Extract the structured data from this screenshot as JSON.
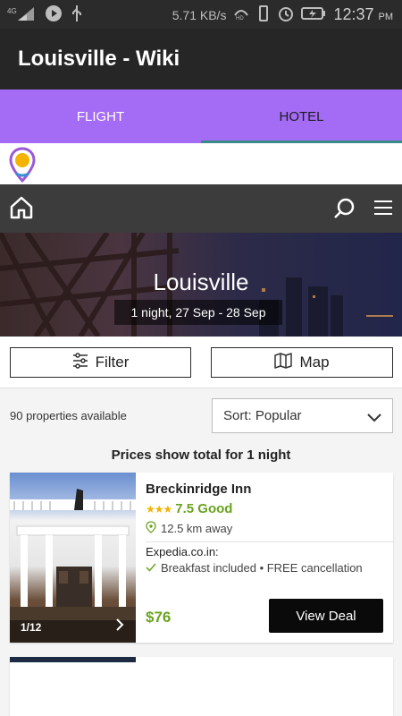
{
  "status_bar": {
    "net_speed": "5.71 KB/s",
    "time": "12:37",
    "ampm": "PM",
    "icons": [
      "signal-4g-icon",
      "play-icon",
      "usb-icon",
      "hd-icon",
      "vibrate-icon",
      "alarm-icon",
      "battery-icon"
    ]
  },
  "app_bar": {
    "title": "Louisville - Wiki"
  },
  "tabs": [
    {
      "label": "FLIGHT",
      "active": false
    },
    {
      "label": "HOTEL",
      "active": true
    }
  ],
  "site_header": {
    "icons": [
      "location-pin-logo",
      "home-icon",
      "search-icon",
      "hamburger-menu-icon"
    ]
  },
  "hero": {
    "city": "Louisville",
    "dates": "1 night, 27 Sep - 28 Sep"
  },
  "filter_bar": {
    "filter_label": "Filter",
    "map_label": "Map"
  },
  "results": {
    "count_text": "90 properties available",
    "sort_label": "Sort: Popular",
    "price_note": "Prices show total for 1 night"
  },
  "hotels": [
    {
      "name": "Breckinridge Inn",
      "stars": 3,
      "rating": "7.5 Good",
      "distance": "12.5 km away",
      "provider": "Expedia.co.in:",
      "perks": "Breakfast included • FREE cancellation",
      "price": "$76",
      "photo_counter": "1/12",
      "cta": "View Deal"
    }
  ],
  "colors": {
    "tab_bar": "#a46bf5",
    "app_bar": "#262626",
    "site_header": "#3c3c3c",
    "accent_green": "#6aa321",
    "star_yellow": "#f2b400",
    "tab_indicator": "#3a8a8a"
  }
}
